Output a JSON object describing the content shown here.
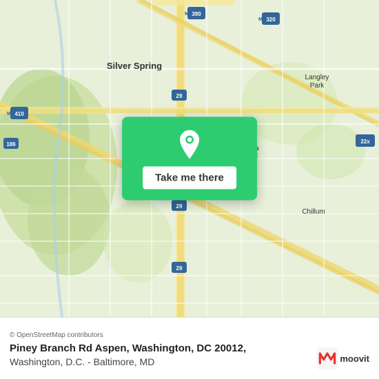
{
  "map": {
    "alt": "Map of Silver Spring and surrounding Washington DC area"
  },
  "overlay": {
    "button_label": "Take me there",
    "pin_icon": "location-pin"
  },
  "info_bar": {
    "attribution": "© OpenStreetMap contributors",
    "location_title": "Piney Branch Rd Aspen, Washington, DC 20012,",
    "location_subtitle": "Washington, D.C. - Baltimore, MD"
  },
  "branding": {
    "logo_text": "moovit"
  },
  "colors": {
    "green": "#2ecc71",
    "white": "#ffffff",
    "dark_text": "#222222"
  }
}
